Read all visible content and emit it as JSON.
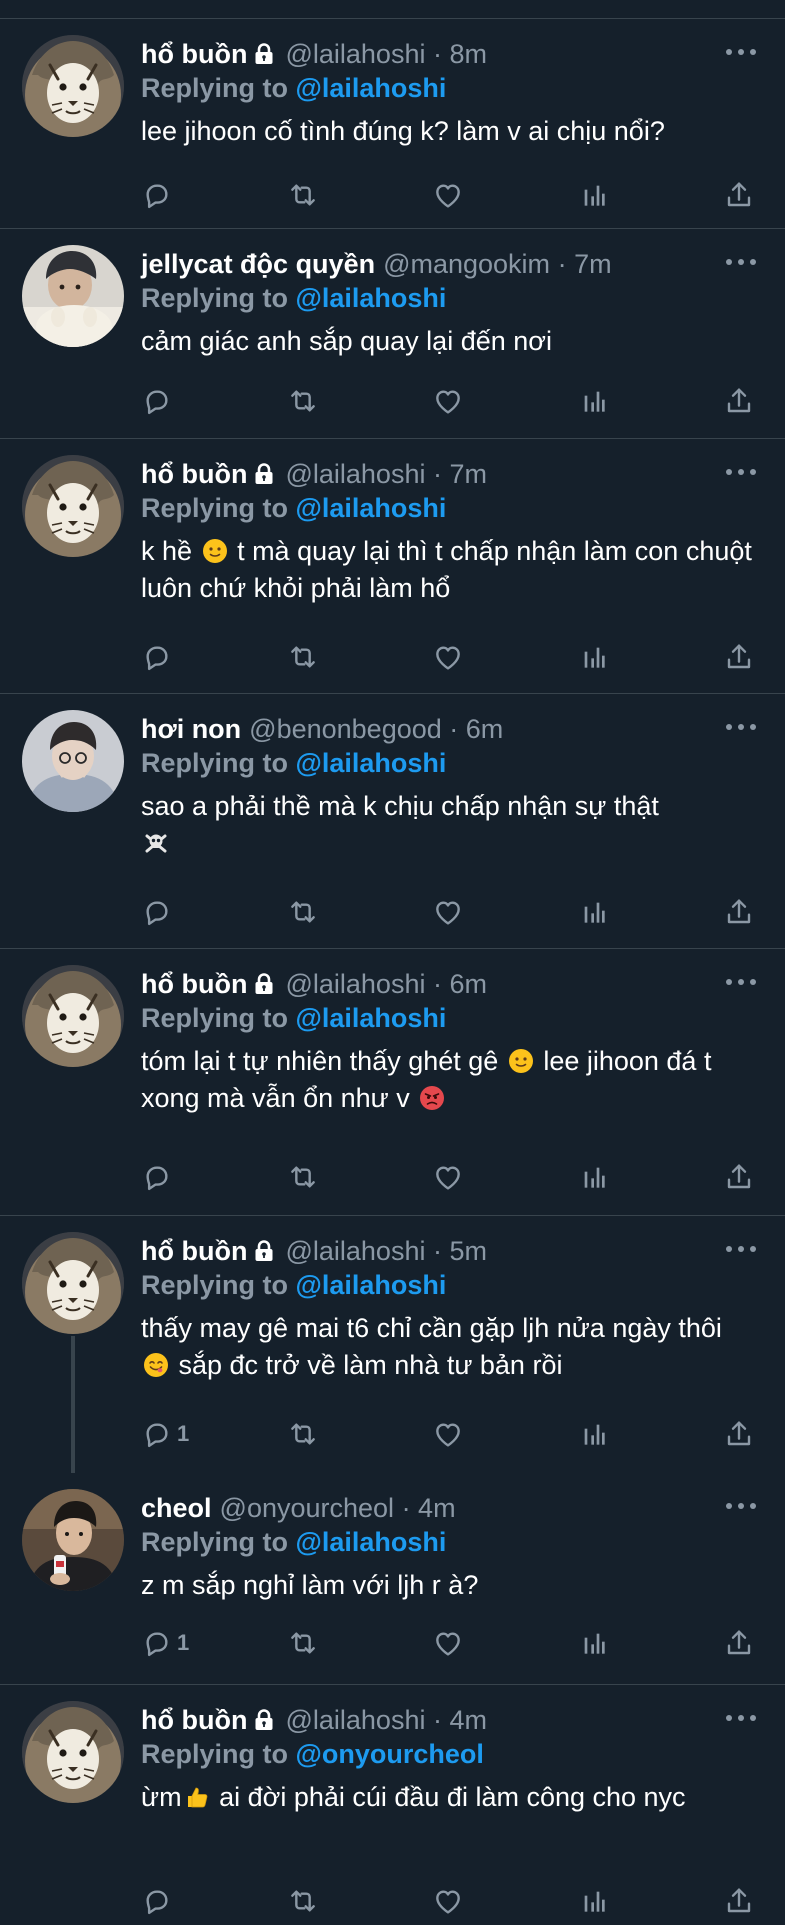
{
  "colors": {
    "background": "#15202b",
    "divider": "#38444d",
    "muted": "#8b98a5",
    "accent": "#1d9bf0",
    "text": "#ffffff"
  },
  "icons": {
    "reply": "reply-icon",
    "retweet": "retweet-icon",
    "like": "heart-icon",
    "analytics": "analytics-icon",
    "share": "share-icon",
    "more": "more-icon",
    "lock": "lock-icon"
  },
  "tweets": [
    {
      "name": "hổ buồn",
      "locked": true,
      "handle": "@lailahoshi",
      "time": "· 8m",
      "replying_prefix": "Replying to",
      "replying_to": "@lailahoshi",
      "text": "lee jihoon cố tình đúng k? làm v ai chịu nổi?",
      "reply_count": ""
    },
    {
      "name": "jellycat độc quyền",
      "locked": false,
      "handle": "@mangookim",
      "time": "· 7m",
      "replying_prefix": "Replying to",
      "replying_to": "@lailahoshi",
      "text": "cảm giác anh sắp quay lại đến nơi",
      "reply_count": ""
    },
    {
      "name": "hổ buồn",
      "locked": true,
      "handle": "@lailahoshi",
      "time": "· 7m",
      "replying_prefix": "Replying to",
      "replying_to": "@lailahoshi",
      "text_a": "k hề",
      "text_b": " t mà quay lại thì t chấp nhận làm con chuột luôn chứ khỏi phải làm hổ",
      "reply_count": ""
    },
    {
      "name": "hơi non",
      "locked": false,
      "handle": "@benonbegood",
      "time": "· 6m",
      "replying_prefix": "Replying to",
      "replying_to": "@lailahoshi",
      "text": "sao a phải thề mà k chịu chấp nhận sự thật",
      "text_emoji": "☠",
      "reply_count": ""
    },
    {
      "name": "hổ buồn",
      "locked": true,
      "handle": "@lailahoshi",
      "time": "· 6m",
      "replying_prefix": "Replying to",
      "replying_to": "@lailahoshi",
      "text_a": "tóm lại t tự nhiên thấy ghét gê",
      "text_b": " lee jihoon đá t xong mà vẫn ổn như v",
      "reply_count": ""
    },
    {
      "name": "hổ buồn",
      "locked": true,
      "handle": "@lailahoshi",
      "time": "· 5m",
      "replying_prefix": "Replying to",
      "replying_to": "@lailahoshi",
      "text_a": "thấy may gê mai t6 chỉ cần gặp ljh nửa ngày thôi",
      "text_b": " sắp đc trở về làm nhà tư bản rồi",
      "reply_count": "1"
    },
    {
      "name": "cheol",
      "locked": false,
      "handle": "@onyourcheol",
      "time": "· 4m",
      "replying_prefix": "Replying to",
      "replying_to": "@lailahoshi",
      "text": "z m sắp nghỉ làm với ljh r à?",
      "reply_count": "1"
    },
    {
      "name": "hổ buồn",
      "locked": true,
      "handle": "@lailahoshi",
      "time": "· 4m",
      "replying_prefix": "Replying to",
      "replying_to": "@onyourcheol",
      "text_a": "ừm",
      "text_b": " ai đời phải cúi đầu đi làm công cho nyc",
      "reply_count": ""
    }
  ]
}
